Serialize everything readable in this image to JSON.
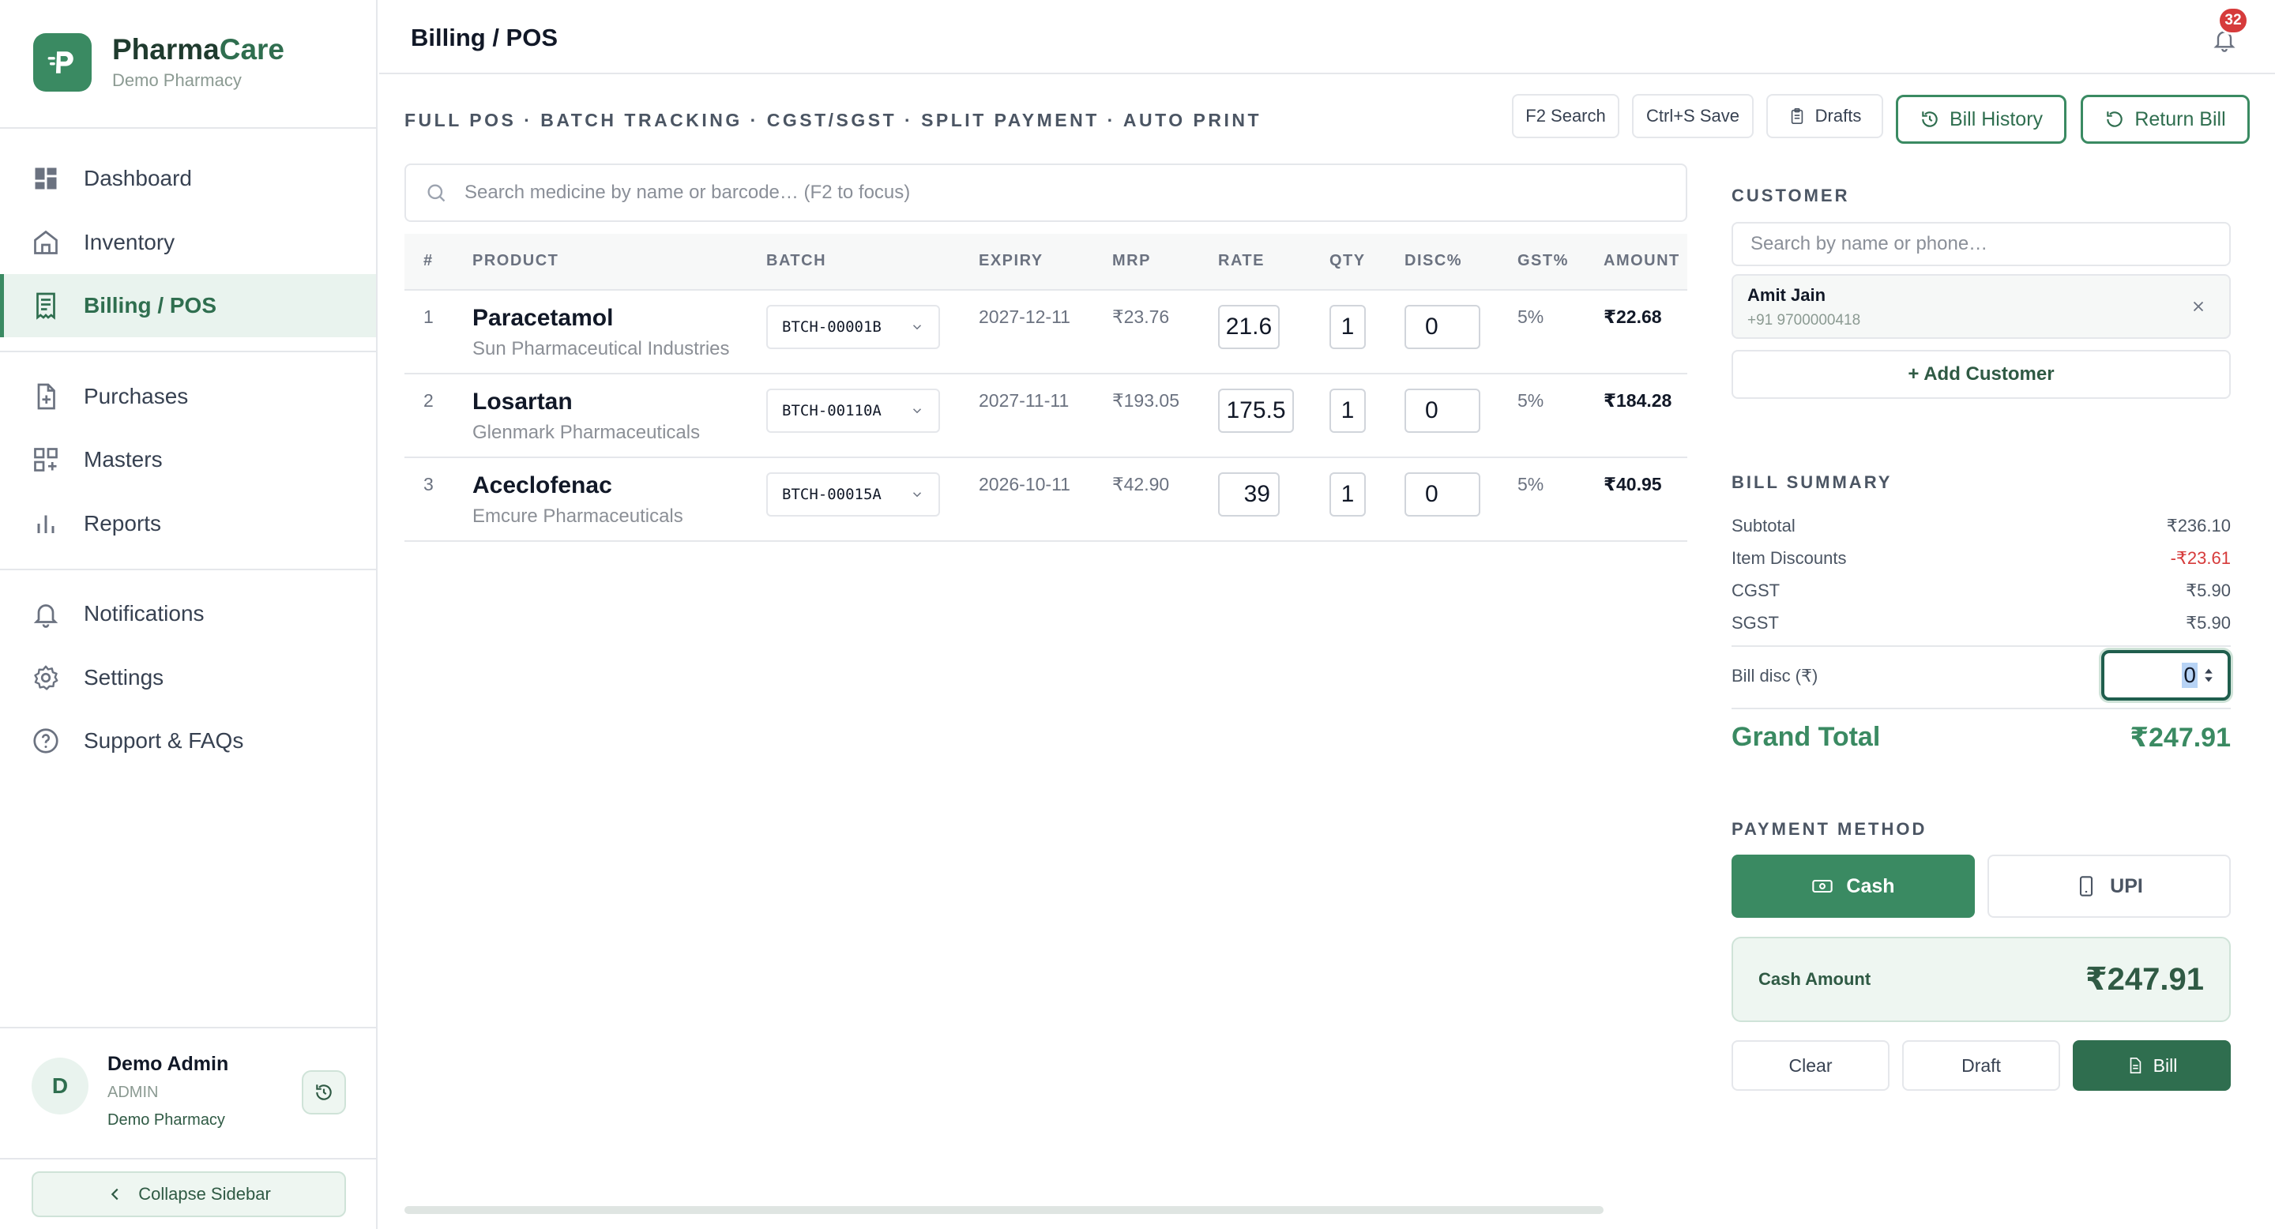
{
  "brand": {
    "name_part1": "Pharma",
    "name_part2": "Care",
    "subtitle": "Demo Pharmacy"
  },
  "nav": {
    "dashboard": "Dashboard",
    "inventory": "Inventory",
    "billing": "Billing / POS",
    "purchases": "Purchases",
    "masters": "Masters",
    "reports": "Reports",
    "notifications": "Notifications",
    "settings": "Settings",
    "support": "Support & FAQs"
  },
  "user": {
    "initial": "D",
    "name": "Demo Admin",
    "role": "ADMIN",
    "org": "Demo Pharmacy"
  },
  "collapse_label": "Collapse Sidebar",
  "header": {
    "title": "Billing / POS",
    "notification_count": "32"
  },
  "toolbar": {
    "subtitle": "FULL POS · BATCH TRACKING · CGST/SGST · SPLIT PAYMENT · AUTO PRINT",
    "f2": "F2 Search",
    "save": "Ctrl+S Save",
    "drafts": "Drafts",
    "history": "Bill History",
    "return": "Return Bill"
  },
  "search": {
    "placeholder": "Search medicine by name or barcode… (F2 to focus)"
  },
  "table": {
    "headers": {
      "num": "#",
      "product": "PRODUCT",
      "batch": "BATCH",
      "expiry": "EXPIRY",
      "mrp": "MRP",
      "rate": "RATE",
      "qty": "QTY",
      "disc": "DISC%",
      "gst": "GST%",
      "amount": "AMOUNT"
    },
    "rows": [
      {
        "num": "1",
        "name": "Paracetamol",
        "mfr": "Sun Pharmaceutical Industries",
        "batch": "BTCH-00001B",
        "expiry": "2027-12-11",
        "mrp": "₹23.76",
        "rate": "21.6",
        "qty": "1",
        "disc": "0",
        "gst": "5%",
        "amount": "₹22.68"
      },
      {
        "num": "2",
        "name": "Losartan",
        "mfr": "Glenmark Pharmaceuticals",
        "batch": "BTCH-00110A",
        "expiry": "2027-11-11",
        "mrp": "₹193.05",
        "rate": "175.5",
        "qty": "1",
        "disc": "0",
        "gst": "5%",
        "amount": "₹184.28"
      },
      {
        "num": "3",
        "name": "Aceclofenac",
        "mfr": "Emcure Pharmaceuticals",
        "batch": "BTCH-00015A",
        "expiry": "2026-10-11",
        "mrp": "₹42.90",
        "rate": "39",
        "qty": "1",
        "disc": "0",
        "gst": "5%",
        "amount": "₹40.95"
      }
    ]
  },
  "customer": {
    "label": "CUSTOMER",
    "placeholder": "Search by name or phone…",
    "name": "Amit Jain",
    "phone": "+91 9700000418",
    "add": "+ Add Customer"
  },
  "summary": {
    "label": "BILL SUMMARY",
    "subtotal_label": "Subtotal",
    "subtotal": "₹236.10",
    "discounts_label": "Item Discounts",
    "discounts": "-₹23.61",
    "cgst_label": "CGST",
    "cgst": "₹5.90",
    "sgst_label": "SGST",
    "sgst": "₹5.90",
    "bill_disc_label": "Bill disc (₹)",
    "bill_disc": "0",
    "grand_label": "Grand Total",
    "grand": "₹247.91"
  },
  "payment": {
    "label": "PAYMENT METHOD",
    "cash": "Cash",
    "upi": "UPI",
    "cash_amount_label": "Cash Amount",
    "cash_amount": "₹247.91"
  },
  "actions": {
    "clear": "Clear",
    "draft": "Draft",
    "bill": "Bill"
  },
  "colors": {
    "accent": "#3a8a62",
    "accent_dark": "#2f6e4f",
    "danger": "#d63b3b"
  }
}
